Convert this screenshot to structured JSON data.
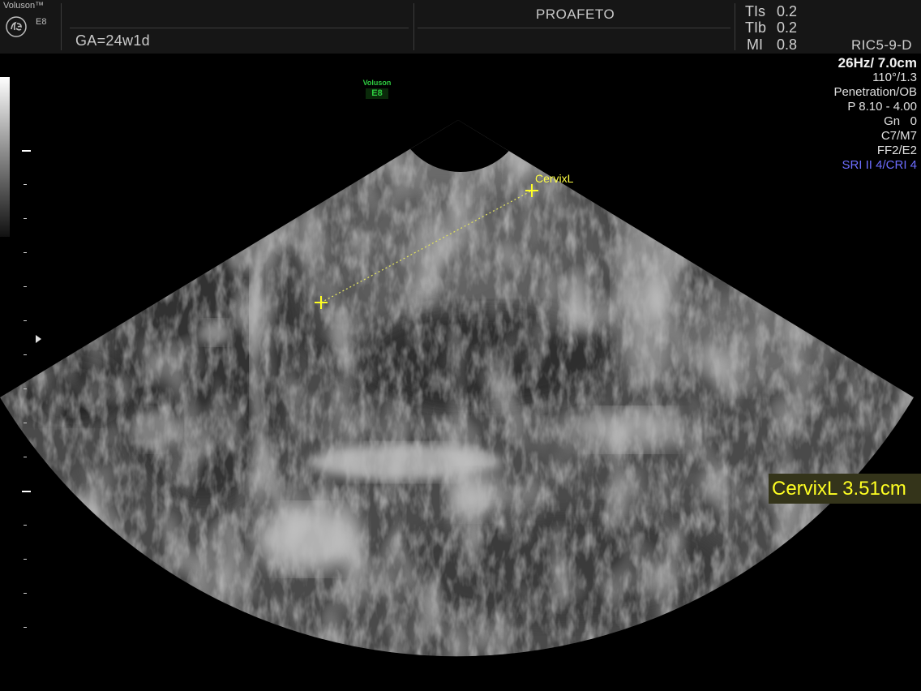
{
  "header": {
    "brand_name": "Voluson™",
    "brand_model": "E8",
    "gestational_age": "GA=24w1d",
    "institution": "PROAFETO",
    "indices": [
      {
        "label": "TIs",
        "value": "0.2"
      },
      {
        "label": "TIb",
        "value": "0.2"
      },
      {
        "label": "MI",
        "value": "0.8"
      }
    ],
    "probe": "RIC5-9-D"
  },
  "parameters": {
    "frame_depth": "26Hz/ 7.0cm",
    "angle_quality": "110°/1.3",
    "preset": "Penetration/OB",
    "power": "P 8.10 - 4.00",
    "gain": "Gn   0",
    "filters": "C7/M7",
    "frequency": "FF2/E2",
    "sri_cri": "SRI II 4/CRI 4"
  },
  "badge": {
    "line1": "Voluson",
    "line2": "E8"
  },
  "measurement": {
    "caliper_name": "CervixL",
    "result": "CervixL 3.51cm",
    "value_cm": 3.51
  },
  "colors": {
    "caliper": "#ffff22",
    "sri_text": "#6d6dff",
    "badge_green": "#2ecc40",
    "header_bg": "#161616"
  },
  "icons": {
    "logo": "ge-logo-icon",
    "focus": "focus-marker-icon",
    "caliper": "crosshair-icon"
  }
}
